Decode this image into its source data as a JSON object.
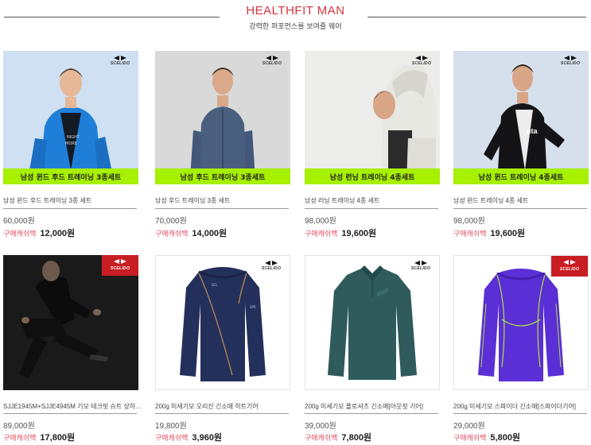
{
  "section": {
    "title": "HEALTHFIT MAN",
    "subtitle": "강력한 퍼포먼스를 보여줄 웨어"
  },
  "brand": {
    "logo_text": "SCELIDO",
    "accent": "#d6333b",
    "banner_color": "#a6f000",
    "cashback_color": "#e2485a"
  },
  "products": [
    {
      "banner": "남성 윈드 후드 트레이닝 3종세트",
      "name": "남성 윈드 후드 트레이닝 3종 세트",
      "price": "60,000원",
      "cashback_label": "구매캐쉬백",
      "cashback_value": "12,000원"
    },
    {
      "banner": "남성 후드 트레이닝 3종세트",
      "name": "남성 후드 트레이닝 3종 세트",
      "price": "70,000원",
      "cashback_label": "구매캐쉬백",
      "cashback_value": "14,000원"
    },
    {
      "banner": "남성 런닝 트레이닝 4종세트",
      "name": "남성 러닝 트레이닝 4종 세트",
      "price": "98,000원",
      "cashback_label": "구매캐쉬백",
      "cashback_value": "19,600원"
    },
    {
      "banner": "남성 윈드 트레이닝 4종세트",
      "name": "남성 윈드 트레이닝 4종 세트",
      "price": "98,000원",
      "cashback_label": "구매캐쉬백",
      "cashback_value": "19,600원"
    },
    {
      "name": "SJJE1945M+SJJE4945M 기모 테크핏 슈트 상하의...",
      "price": "89,000원",
      "cashback_label": "구매캐쉬백",
      "cashback_value": "17,800원"
    },
    {
      "name": "200g 미세기모 오리진 긴소매 히트기어",
      "price": "19,800원",
      "cashback_label": "구매캐쉬백",
      "cashback_value": "3,960원"
    },
    {
      "name": "200g 미세기모 폴로셔츠 긴소매[아웃핏 기어]",
      "price": "39,000원",
      "cashback_label": "구매캐쉬백",
      "cashback_value": "7,800원"
    },
    {
      "name": "200g 미세기모 스파이더 긴소매[스파이더기어]",
      "price": "29,000원",
      "cashback_label": "구매캐쉬백",
      "cashback_value": "5,800원"
    }
  ]
}
